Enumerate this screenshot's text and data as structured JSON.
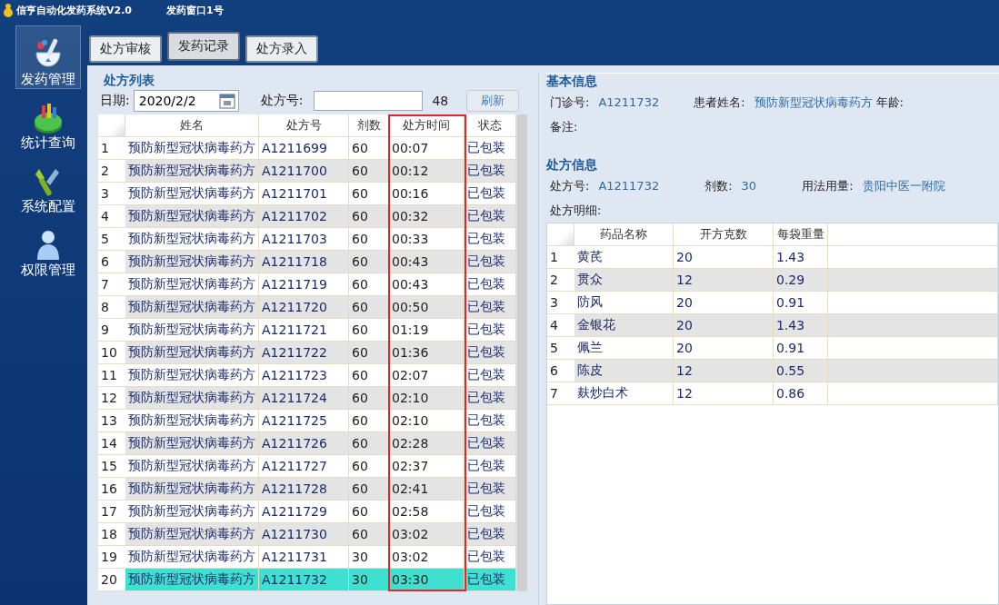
{
  "app": {
    "title": "信亨自动化发药系统V2.0",
    "station": "发药窗口1号"
  },
  "nav": [
    {
      "label": "发药管理",
      "kind": "mortar",
      "selected": true
    },
    {
      "label": "统计查询",
      "kind": "chart",
      "selected": false
    },
    {
      "label": "系统配置",
      "kind": "tools",
      "selected": false
    },
    {
      "label": "权限管理",
      "kind": "user",
      "selected": false
    }
  ],
  "tabs": [
    {
      "label": "处方审核",
      "selected": false
    },
    {
      "label": "发药记录",
      "selected": true
    },
    {
      "label": "处方录入",
      "selected": false
    }
  ],
  "list": {
    "title": "处方列表",
    "date_label": "日期:",
    "date": "2020/2/2",
    "rx_label": "处方号:",
    "count": "48",
    "refresh": "刷新",
    "columns": [
      "姓名",
      "处方号",
      "剂数",
      "处方时间",
      "状态"
    ],
    "rows": [
      {
        "no": "1",
        "name": "预防新型冠状病毒药方",
        "rx": "A1211699",
        "doses": "60",
        "time": "00:07",
        "status": "已包装",
        "selected": false
      },
      {
        "no": "2",
        "name": "预防新型冠状病毒药方",
        "rx": "A1211700",
        "doses": "60",
        "time": "00:12",
        "status": "已包装",
        "selected": false
      },
      {
        "no": "3",
        "name": "预防新型冠状病毒药方",
        "rx": "A1211701",
        "doses": "60",
        "time": "00:16",
        "status": "已包装",
        "selected": false
      },
      {
        "no": "4",
        "name": "预防新型冠状病毒药方",
        "rx": "A1211702",
        "doses": "60",
        "time": "00:32",
        "status": "已包装",
        "selected": false
      },
      {
        "no": "5",
        "name": "预防新型冠状病毒药方",
        "rx": "A1211703",
        "doses": "60",
        "time": "00:33",
        "status": "已包装",
        "selected": false
      },
      {
        "no": "6",
        "name": "预防新型冠状病毒药方",
        "rx": "A1211718",
        "doses": "60",
        "time": "00:43",
        "status": "已包装",
        "selected": false
      },
      {
        "no": "7",
        "name": "预防新型冠状病毒药方",
        "rx": "A1211719",
        "doses": "60",
        "time": "00:43",
        "status": "已包装",
        "selected": false
      },
      {
        "no": "8",
        "name": "预防新型冠状病毒药方",
        "rx": "A1211720",
        "doses": "60",
        "time": "00:50",
        "status": "已包装",
        "selected": false
      },
      {
        "no": "9",
        "name": "预防新型冠状病毒药方",
        "rx": "A1211721",
        "doses": "60",
        "time": "01:19",
        "status": "已包装",
        "selected": false
      },
      {
        "no": "10",
        "name": "预防新型冠状病毒药方",
        "rx": "A1211722",
        "doses": "60",
        "time": "01:36",
        "status": "已包装",
        "selected": false
      },
      {
        "no": "11",
        "name": "预防新型冠状病毒药方",
        "rx": "A1211723",
        "doses": "60",
        "time": "02:07",
        "status": "已包装",
        "selected": false
      },
      {
        "no": "12",
        "name": "预防新型冠状病毒药方",
        "rx": "A1211724",
        "doses": "60",
        "time": "02:10",
        "status": "已包装",
        "selected": false
      },
      {
        "no": "13",
        "name": "预防新型冠状病毒药方",
        "rx": "A1211725",
        "doses": "60",
        "time": "02:10",
        "status": "已包装",
        "selected": false
      },
      {
        "no": "14",
        "name": "预防新型冠状病毒药方",
        "rx": "A1211726",
        "doses": "60",
        "time": "02:28",
        "status": "已包装",
        "selected": false
      },
      {
        "no": "15",
        "name": "预防新型冠状病毒药方",
        "rx": "A1211727",
        "doses": "60",
        "time": "02:37",
        "status": "已包装",
        "selected": false
      },
      {
        "no": "16",
        "name": "预防新型冠状病毒药方",
        "rx": "A1211728",
        "doses": "60",
        "time": "02:41",
        "status": "已包装",
        "selected": false
      },
      {
        "no": "17",
        "name": "预防新型冠状病毒药方",
        "rx": "A1211729",
        "doses": "60",
        "time": "02:58",
        "status": "已包装",
        "selected": false
      },
      {
        "no": "18",
        "name": "预防新型冠状病毒药方",
        "rx": "A1211730",
        "doses": "60",
        "time": "03:02",
        "status": "已包装",
        "selected": false
      },
      {
        "no": "19",
        "name": "预防新型冠状病毒药方",
        "rx": "A1211731",
        "doses": "30",
        "time": "03:02",
        "status": "已包装",
        "selected": false
      },
      {
        "no": "20",
        "name": "预防新型冠状病毒药方",
        "rx": "A1211732",
        "doses": "30",
        "time": "03:30",
        "status": "已包装",
        "selected": true
      }
    ]
  },
  "basic": {
    "title": "基本信息",
    "clinic_label": "门诊号:",
    "clinic": "A1211732",
    "patient_label": "患者姓名:",
    "patient": "预防新型冠状病毒药方",
    "age_label": "年龄:",
    "note_label": "备注:"
  },
  "rx_info": {
    "title": "处方信息",
    "rx_label": "处方号:",
    "rx": "A1211732",
    "doses_label": "剂数:",
    "doses": "30",
    "usage_label": "用法用量:",
    "usage": "贵阳中医一附院",
    "detail_label": "处方明细:",
    "columns": [
      "药品名称",
      "开方克数",
      "每袋重量"
    ],
    "rows": [
      {
        "no": "1",
        "herb": "黄芪",
        "grams": "20",
        "weight": "1.43"
      },
      {
        "no": "2",
        "herb": "贯众",
        "grams": "12",
        "weight": "0.29"
      },
      {
        "no": "3",
        "herb": "防风",
        "grams": "20",
        "weight": "0.91"
      },
      {
        "no": "4",
        "herb": "金银花",
        "grams": "20",
        "weight": "1.43"
      },
      {
        "no": "5",
        "herb": "佩兰",
        "grams": "20",
        "weight": "0.91"
      },
      {
        "no": "6",
        "herb": "陈皮",
        "grams": "12",
        "weight": "0.55"
      },
      {
        "no": "7",
        "herb": "麸炒白术",
        "grams": "12",
        "weight": "0.86"
      }
    ]
  }
}
